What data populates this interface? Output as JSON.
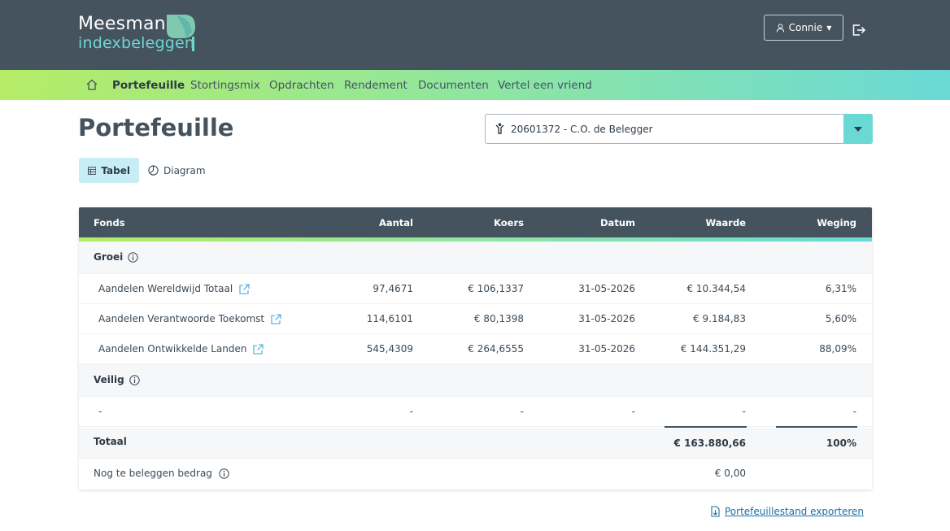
{
  "brand": {
    "name_line1": "Meesman",
    "name_line2": "indexbeleggen"
  },
  "header": {
    "user_label": "Connie",
    "user_icon": "person-icon",
    "logout_icon": "logout-icon"
  },
  "nav": {
    "home_icon": "home-icon",
    "items": [
      {
        "label": "Portefeuille",
        "active": true
      },
      {
        "label": "Stortingsmix"
      },
      {
        "label": "Opdrachten"
      },
      {
        "label": "Rendement"
      },
      {
        "label": "Documenten"
      },
      {
        "label": "Vertel een vriend"
      }
    ]
  },
  "page": {
    "title": "Portefeuille"
  },
  "account": {
    "selected": "20601372 - C.O. de Belegger"
  },
  "view_tabs": [
    {
      "label": "Tabel",
      "icon": "table-icon",
      "active": true
    },
    {
      "label": "Diagram",
      "icon": "pie-chart-icon"
    }
  ],
  "table": {
    "columns": [
      "Fonds",
      "Aantal",
      "Koers",
      "Datum",
      "Waarde",
      "Weging"
    ],
    "groups": [
      {
        "label": "Groei",
        "rows": [
          {
            "fund": "Aandelen Wereldwijd Totaal",
            "aantal": "97,4671",
            "koers": "€ 106,1337",
            "datum": "31-05-2026",
            "waarde": "€ 10.344,54",
            "weging": "6,31%"
          },
          {
            "fund": "Aandelen Verantwoorde Toekomst",
            "aantal": "114,6101",
            "koers": "€ 80,1398",
            "datum": "31-05-2026",
            "waarde": "€ 9.184,83",
            "weging": "5,60%"
          },
          {
            "fund": "Aandelen Ontwikkelde Landen",
            "aantal": "545,4309",
            "koers": "€ 264,6555",
            "datum": "31-05-2026",
            "waarde": "€ 144.351,29",
            "weging": "88,09%"
          }
        ]
      },
      {
        "label": "Veilig",
        "rows": [
          {
            "fund": "-",
            "aantal": "-",
            "koers": "-",
            "datum": "-",
            "waarde": "-",
            "weging": "-"
          }
        ]
      }
    ],
    "total": {
      "label": "Totaal",
      "waarde": "€ 163.880,66",
      "weging": "100%"
    },
    "to_invest": {
      "label": "Nog te beleggen bedrag",
      "waarde": "€ 0,00"
    }
  },
  "export": {
    "label": "Portefeuillestand exporteren"
  },
  "colors": {
    "header_bg": "#45535f",
    "accent_green": "#b5ec66",
    "accent_teal": "#6ad9d6",
    "link": "#1d6fa3"
  }
}
